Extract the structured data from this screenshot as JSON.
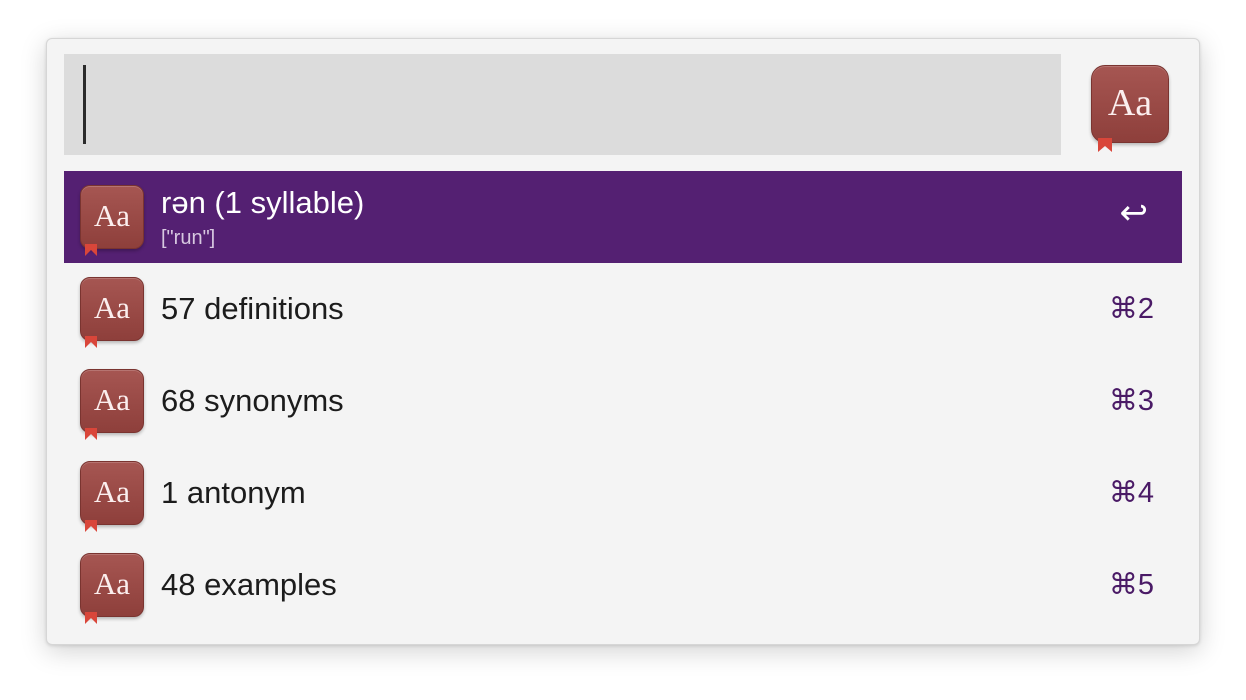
{
  "search": {
    "value": "",
    "placeholder": ""
  },
  "header": {
    "app_icon_text": "Aa",
    "app_icon_name": "dictionary-app-icon"
  },
  "results": [
    {
      "title": "rən (1 syllable)",
      "subtitle": "[\"run\"]",
      "shortcut": "↩",
      "icon_text": "Aa",
      "selected": true
    },
    {
      "title": "57 definitions",
      "subtitle": "",
      "shortcut": "⌘2",
      "icon_text": "Aa",
      "selected": false
    },
    {
      "title": "68 synonyms",
      "subtitle": "",
      "shortcut": "⌘3",
      "icon_text": "Aa",
      "selected": false
    },
    {
      "title": "1 antonym",
      "subtitle": "",
      "shortcut": "⌘4",
      "icon_text": "Aa",
      "selected": false
    },
    {
      "title": "48 examples",
      "subtitle": "",
      "shortcut": "⌘5",
      "icon_text": "Aa",
      "selected": false
    }
  ],
  "colors": {
    "selection": "#542072",
    "shortcut": "#4a1a66",
    "search_field": "#dcdcdc",
    "window": "#f4f4f4",
    "icon": "#9b4a46"
  }
}
